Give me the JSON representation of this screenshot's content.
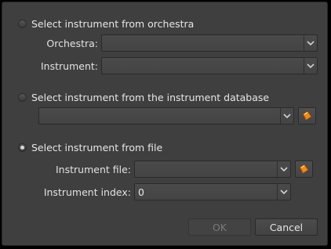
{
  "dialog": {
    "orchestra_option": {
      "label": "Select instrument from orchestra",
      "orchestra_label": "Orchestra:",
      "orchestra_value": "",
      "instrument_label": "Instrument:",
      "instrument_value": ""
    },
    "database_option": {
      "label": "Select instrument from the instrument database",
      "instrument_value": ""
    },
    "file_option": {
      "label": "Select instrument from file",
      "file_label": "Instrument file:",
      "file_value": "",
      "index_label": "Instrument index:",
      "index_value": "0"
    },
    "selected_option": "file",
    "buttons": {
      "ok_label": "OK",
      "cancel_label": "Cancel"
    },
    "colors": {
      "background": "#3f3f3f",
      "folder_icon": "#f08a1c"
    },
    "icons": {
      "browse": "open-folder-icon",
      "dropdown": "chevron-down-icon"
    }
  }
}
